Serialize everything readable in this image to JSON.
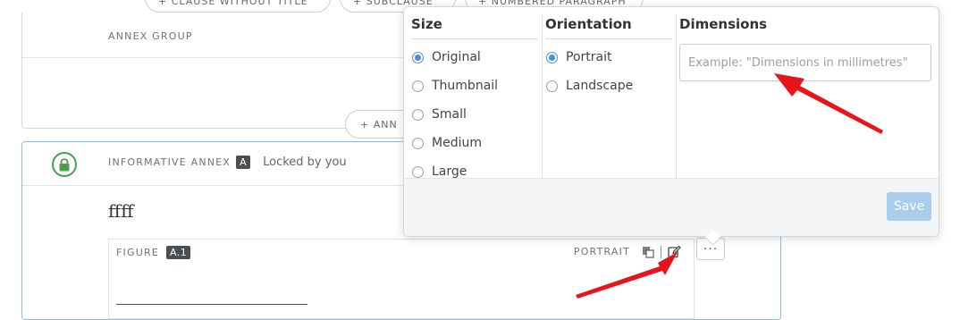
{
  "top_buttons": [
    {
      "label": "+ CLAUSE WITHOUT TITLE"
    },
    {
      "label": "+ SUBCLAUSE"
    },
    {
      "label": "+ NUMBERED PARAGRAPH"
    }
  ],
  "annex_group": {
    "label": "ANNEX GROUP",
    "add_button_label": "+ ANN"
  },
  "informative_annex": {
    "label": "INFORMATIVE ANNEX",
    "badge": "A",
    "lock_status": "Locked by you",
    "body_text": "ffff",
    "figure": {
      "label": "FIGURE",
      "badge": "A.1",
      "orientation": "PORTRAIT",
      "more_label": "···"
    }
  },
  "popup": {
    "size": {
      "title": "Size",
      "options": [
        "Original",
        "Thumbnail",
        "Small",
        "Medium",
        "Large"
      ],
      "selected": "Original"
    },
    "orientation": {
      "title": "Orientation",
      "options": [
        "Portrait",
        "Landscape"
      ],
      "selected": "Portrait"
    },
    "dimensions": {
      "title": "Dimensions",
      "placeholder": "Example: \"Dimensions in millimetres\"",
      "value": ""
    },
    "save_label": "Save"
  },
  "colors": {
    "accent": "#4a90d9",
    "save_disabled": "#a9cdec",
    "lock_green": "#4a9d4a",
    "annotation_arrow": "#e8141c"
  }
}
